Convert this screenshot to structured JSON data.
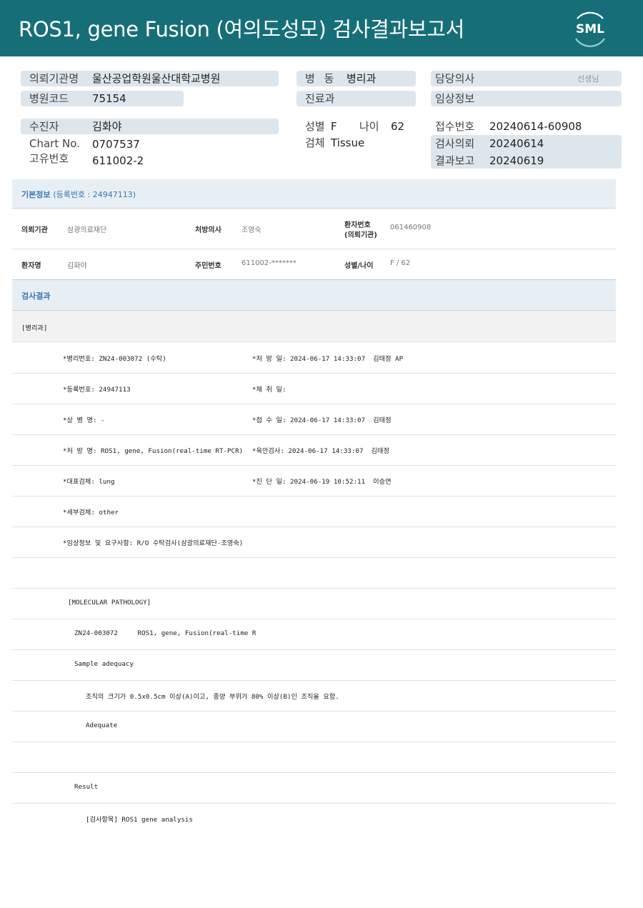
{
  "header": {
    "title": "ROS1, gene Fusion (여의도성모) 검사결과보고서",
    "logo_text": "SML",
    "bg_color": "#166f78"
  },
  "summary": {
    "requesting_org_label": "의뢰기관명",
    "requesting_org_value": "울산공업학원울산대학교병원",
    "hospital_code_label": "병원코드",
    "hospital_code_value": "75154",
    "ward_label": "병 동",
    "ward_value": "병리과",
    "department_label": "진료과",
    "doctor_label": "담당의사",
    "doctor_suffix": "선생님",
    "clinical_info_label": "임상정보",
    "patient_label": "수진자",
    "patient_value": "김화야",
    "chart_no_label": "Chart No.",
    "chart_no_value": "0707537",
    "unique_no_label": "고유번호",
    "unique_no_value": "611002-2",
    "sex_label": "성별",
    "sex_value": "F",
    "age_label": "나이",
    "age_value": "62",
    "specimen_label": "검체",
    "specimen_value": "Tissue",
    "receipt_no_label": "접수번호",
    "receipt_no_value": "20240614-60908",
    "test_request_label": "검사의뢰",
    "test_request_value": "20240614",
    "result_report_label": "결과보고",
    "result_report_value": "20240619"
  },
  "basic_info": {
    "title": "기본정보",
    "registration": "(등록번호 : 24947113)",
    "org_label": "의뢰기관",
    "org_value": "삼광의료재단",
    "prescriber_label": "처방의사",
    "prescriber_value": "조영숙",
    "patient_no_label": "환자번호",
    "patient_no_label2": "(의뢰기관)",
    "patient_no_value": "061460908",
    "name_label": "환자명",
    "name_value": "김화야",
    "rrn_label": "주민번호",
    "rrn_value": "611002-*******",
    "sexage_label": "성별/나이",
    "sexage_value": "F / 62"
  },
  "results": {
    "title": "검사결과",
    "section_label": "[병리과]",
    "lines": [
      {
        "left": "*병리번호: ZN24-003072 (수탁)",
        "right": "*처 방 일: 2024-06-17 14:33:07  김태정 AP"
      },
      {
        "left": "*등록번호: 24947113",
        "right": "*채 취 일:"
      },
      {
        "left": "*상 병 명: -",
        "right": "*접 수 일: 2024-06-17 14:33:07  김태정"
      },
      {
        "left": "*처 방 명: ROS1, gene, Fusion(real-time RT-PCR)",
        "right": "*육안검사: 2024-06-17 14:33:07  김태정"
      },
      {
        "left": "*대표검체: lung",
        "right": "*진 단 일: 2024-06-19 10:52:11  이승연"
      },
      {
        "left": "*세부검체: other",
        "right": ""
      },
      {
        "left": "*임상정보 및 요구사항: R/O 수탁검사(삼광의료재단-조영숙)",
        "right": ""
      },
      {
        "left": "",
        "right": ""
      },
      {
        "left": "[MOLECULAR PATHOLOGY]",
        "right": ""
      },
      {
        "left": "ZN24-003072     ROS1, gene, Fusion(real-time R",
        "right": ""
      },
      {
        "left": "Sample adequacy",
        "right": ""
      },
      {
        "left": "조직의 크기가 0.5x0.5cm 이상(A)이고, 종양 부위가 80% 이상(B)인 조직을 요함.",
        "right": ""
      },
      {
        "left": "Adequate",
        "right": ""
      },
      {
        "left": "",
        "right": ""
      },
      {
        "left": "Result",
        "right": ""
      },
      {
        "left": "[검사항목] ROS1 gene analysis",
        "right": ""
      }
    ]
  }
}
